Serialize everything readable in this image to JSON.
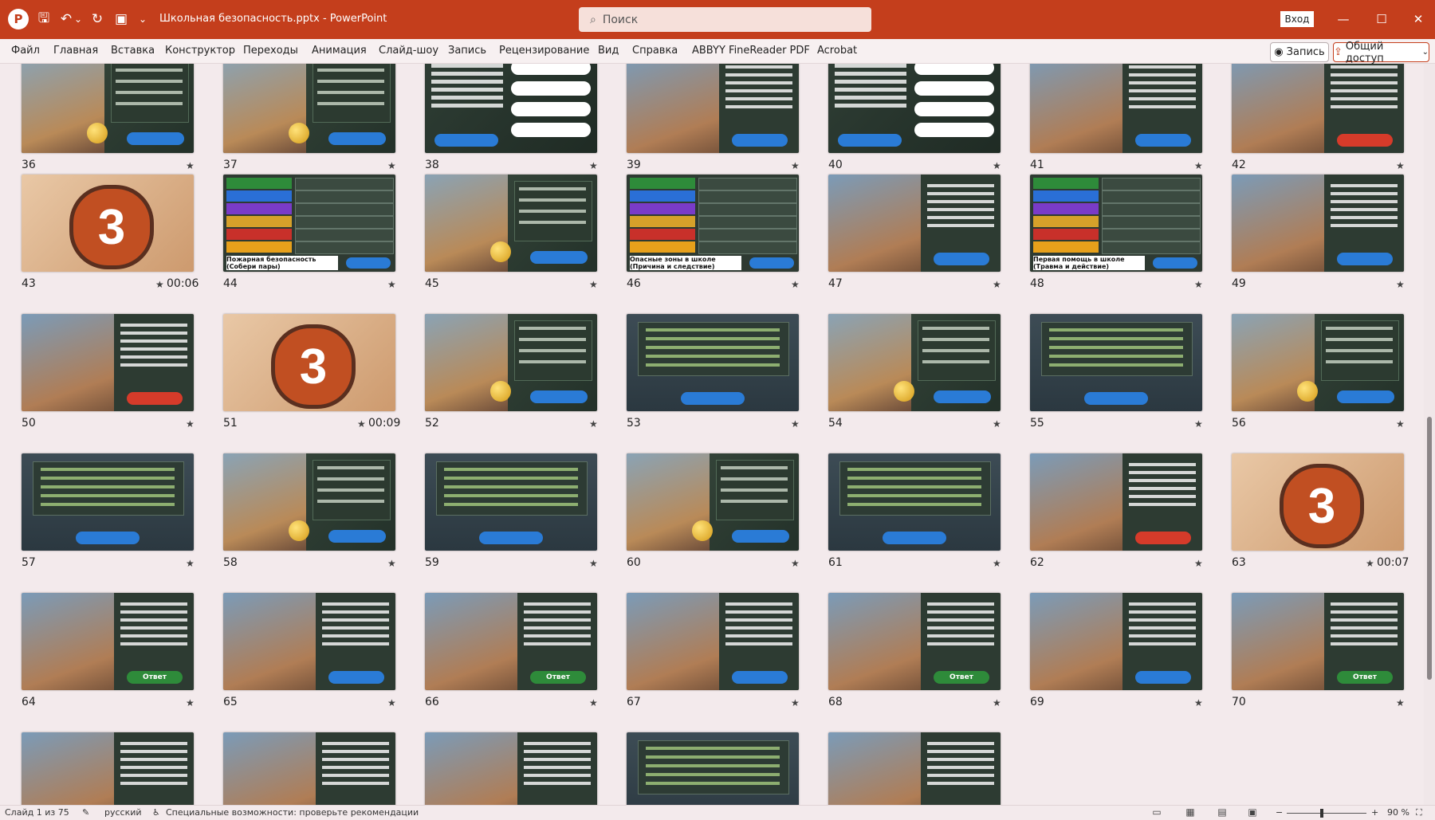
{
  "titlebar": {
    "app_logo": "P",
    "document_title": "Школьная безопасность.pptx  -  PowerPoint",
    "search_placeholder": "Поиск",
    "signin_label": "Вход",
    "qat": {
      "save": "🖫",
      "undo": "↶",
      "undo_dd": "⌄",
      "redo": "↻",
      "present": "▣",
      "customize": "⌄"
    },
    "window": {
      "minimize": "—",
      "maximize": "☐",
      "close": "✕"
    }
  },
  "ribbon": {
    "tabs": [
      "Файл",
      "Главная",
      "Вставка",
      "Конструктор",
      "Переходы",
      "Анимация",
      "Слайд-шоу",
      "Запись",
      "Рецензирование",
      "Вид",
      "Справка",
      "ABBYY FineReader PDF",
      "Acrobat"
    ],
    "record_button": "Запись",
    "share_button": "Общий доступ"
  },
  "slides": [
    {
      "n": "36",
      "style": "dark",
      "duration": ""
    },
    {
      "n": "37",
      "style": "dark",
      "duration": ""
    },
    {
      "n": "38",
      "style": "q",
      "duration": ""
    },
    {
      "n": "39",
      "style": "photo",
      "duration": ""
    },
    {
      "n": "40",
      "style": "q",
      "duration": ""
    },
    {
      "n": "41",
      "style": "photo",
      "duration": ""
    },
    {
      "n": "42",
      "style": "photo-red",
      "duration": ""
    },
    {
      "n": "43",
      "style": "orange",
      "duration": "00:06"
    },
    {
      "n": "44",
      "style": "pairs",
      "duration": ""
    },
    {
      "n": "45",
      "style": "dark",
      "duration": ""
    },
    {
      "n": "46",
      "style": "pairs",
      "duration": ""
    },
    {
      "n": "47",
      "style": "photo",
      "duration": ""
    },
    {
      "n": "48",
      "style": "pairs",
      "duration": ""
    },
    {
      "n": "49",
      "style": "photo",
      "duration": ""
    },
    {
      "n": "50",
      "style": "photo-red",
      "duration": ""
    },
    {
      "n": "51",
      "style": "orange",
      "duration": "00:09"
    },
    {
      "n": "52",
      "style": "dark",
      "duration": ""
    },
    {
      "n": "53",
      "style": "text",
      "duration": ""
    },
    {
      "n": "54",
      "style": "dark",
      "duration": ""
    },
    {
      "n": "55",
      "style": "text",
      "duration": ""
    },
    {
      "n": "56",
      "style": "dark",
      "duration": ""
    },
    {
      "n": "57",
      "style": "text",
      "duration": ""
    },
    {
      "n": "58",
      "style": "dark",
      "duration": ""
    },
    {
      "n": "59",
      "style": "text",
      "duration": ""
    },
    {
      "n": "60",
      "style": "dark",
      "duration": ""
    },
    {
      "n": "61",
      "style": "text",
      "duration": ""
    },
    {
      "n": "62",
      "style": "photo-red",
      "duration": ""
    },
    {
      "n": "63",
      "style": "orange",
      "duration": "00:07"
    },
    {
      "n": "64",
      "style": "photo-green",
      "duration": ""
    },
    {
      "n": "65",
      "style": "photo",
      "duration": ""
    },
    {
      "n": "66",
      "style": "photo-green",
      "duration": ""
    },
    {
      "n": "67",
      "style": "photo",
      "duration": ""
    },
    {
      "n": "68",
      "style": "photo-green",
      "duration": ""
    },
    {
      "n": "69",
      "style": "photo",
      "duration": ""
    },
    {
      "n": "70",
      "style": "photo-green",
      "duration": ""
    },
    {
      "n": "",
      "style": "photo",
      "duration": ""
    },
    {
      "n": "",
      "style": "photo",
      "duration": ""
    },
    {
      "n": "",
      "style": "photo",
      "duration": ""
    },
    {
      "n": "",
      "style": "text",
      "duration": ""
    },
    {
      "n": "",
      "style": "photo",
      "duration": ""
    }
  ],
  "slide_overlay": {
    "big_number": "3",
    "answer_button": "Ответ",
    "caption_44": "Пожарная безопасность (Собери пары)",
    "caption_46": "Опасные зоны в школе (Причина и следствие)",
    "caption_48": "Первая помощь в школе (Травма и действие)"
  },
  "star_glyph": "★",
  "statusbar": {
    "slide_counter": "Слайд 1 из 75",
    "language": "русский",
    "accessibility": "Специальные возможности: проверьте рекомендации",
    "zoom_minus": "−",
    "zoom_plus": "+",
    "zoom_level": "90 %",
    "fit_icon": "⛶"
  }
}
